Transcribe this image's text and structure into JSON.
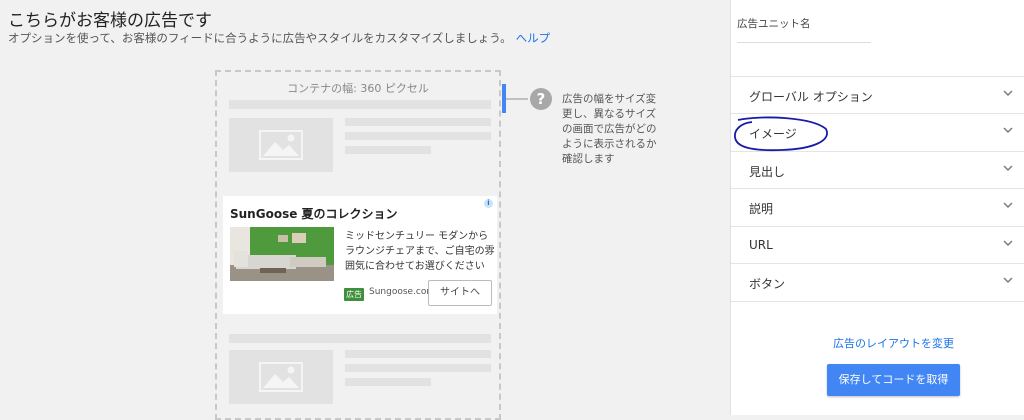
{
  "header": {
    "title": "こちらがお客様の広告です",
    "subtitle": "オプションを使って、お客様のフィードに合うように広告やスタイルをカスタマイズしましょう。",
    "help_link": "ヘルプ"
  },
  "preview": {
    "container_width_label": "コンテナの幅: 360 ピクセル",
    "ad": {
      "title": "SunGoose 夏のコレクション",
      "description": "ミッドセンチュリー モダンからラウンジチェアまで、ご自宅の雰囲気に合わせてお選びください",
      "badge": "広告",
      "domain": "Sungoose.com",
      "button_label": "サイトへ",
      "info_icon": "i"
    },
    "help_text": "広告の幅をサイズ変更し、異なるサイズの画面で広告がどのように表示されるか確認します",
    "help_icon": "?"
  },
  "sidebar": {
    "ad_unit_name_label": "広告ユニット名",
    "sections": [
      {
        "label": "グローバル オプション"
      },
      {
        "label": "イメージ"
      },
      {
        "label": "見出し"
      },
      {
        "label": "説明"
      },
      {
        "label": "URL"
      },
      {
        "label": "ボタン"
      }
    ],
    "change_layout_link": "広告のレイアウトを変更",
    "save_button": "保存してコードを取得"
  },
  "colors": {
    "accent": "#4285f4",
    "link": "#1a73e8",
    "annotation": "#1a1aa8",
    "ad_badge": "#3f8f3b"
  }
}
